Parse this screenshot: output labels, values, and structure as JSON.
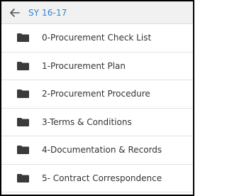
{
  "header": {
    "back_icon": "arrow-left-icon",
    "breadcrumb": "SY 16-17",
    "accent": "#2e86d6"
  },
  "folders": [
    {
      "label": "0-Procurement Check List",
      "icon": "folder-icon"
    },
    {
      "label": "1-Procurement Plan",
      "icon": "folder-icon"
    },
    {
      "label": "2-Procurement Procedure",
      "icon": "folder-icon"
    },
    {
      "label": "3-Terms & Conditions",
      "icon": "folder-icon"
    },
    {
      "label": "4-Documentation & Records",
      "icon": "folder-icon"
    },
    {
      "label": "5- Contract Correspondence",
      "icon": "folder-icon"
    }
  ]
}
